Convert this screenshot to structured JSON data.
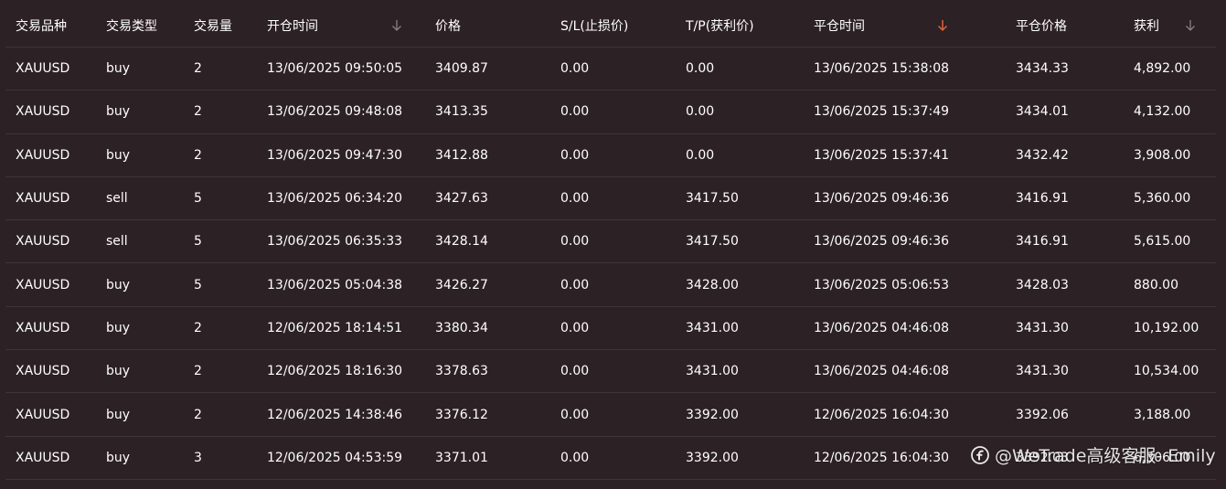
{
  "headers": [
    "交易品种",
    "交易类型",
    "交易量",
    "开仓时间",
    "价格",
    "S/L(止损价)",
    "T/P(获利价)",
    "平仓时间",
    "平仓价格",
    "获利"
  ],
  "sort_icons": {
    "open_time": {
      "icon": "arrow-down-icon",
      "color": "#8a8082"
    },
    "close_time": {
      "icon": "arrow-down-icon",
      "color": "#e0623a"
    },
    "profit": {
      "icon": "arrow-down-icon",
      "color": "#8a8082"
    }
  },
  "rows": [
    [
      "XAUUSD",
      "buy",
      "2",
      "13/06/2025 09:50:05",
      "3409.87",
      "0.00",
      "0.00",
      "13/06/2025 15:38:08",
      "3434.33",
      "4,892.00"
    ],
    [
      "XAUUSD",
      "buy",
      "2",
      "13/06/2025 09:48:08",
      "3413.35",
      "0.00",
      "0.00",
      "13/06/2025 15:37:49",
      "3434.01",
      "4,132.00"
    ],
    [
      "XAUUSD",
      "buy",
      "2",
      "13/06/2025 09:47:30",
      "3412.88",
      "0.00",
      "0.00",
      "13/06/2025 15:37:41",
      "3432.42",
      "3,908.00"
    ],
    [
      "XAUUSD",
      "sell",
      "5",
      "13/06/2025 06:34:20",
      "3427.63",
      "0.00",
      "3417.50",
      "13/06/2025 09:46:36",
      "3416.91",
      "5,360.00"
    ],
    [
      "XAUUSD",
      "sell",
      "5",
      "13/06/2025 06:35:33",
      "3428.14",
      "0.00",
      "3417.50",
      "13/06/2025 09:46:36",
      "3416.91",
      "5,615.00"
    ],
    [
      "XAUUSD",
      "buy",
      "5",
      "13/06/2025 05:04:38",
      "3426.27",
      "0.00",
      "3428.00",
      "13/06/2025 05:06:53",
      "3428.03",
      "880.00"
    ],
    [
      "XAUUSD",
      "buy",
      "2",
      "12/06/2025 18:14:51",
      "3380.34",
      "0.00",
      "3431.00",
      "13/06/2025 04:46:08",
      "3431.30",
      "10,192.00"
    ],
    [
      "XAUUSD",
      "buy",
      "2",
      "12/06/2025 18:16:30",
      "3378.63",
      "0.00",
      "3431.00",
      "13/06/2025 04:46:08",
      "3431.30",
      "10,534.00"
    ],
    [
      "XAUUSD",
      "buy",
      "2",
      "12/06/2025 14:38:46",
      "3376.12",
      "0.00",
      "3392.00",
      "12/06/2025 16:04:30",
      "3392.06",
      "3,188.00"
    ],
    [
      "XAUUSD",
      "buy",
      "3",
      "12/06/2025 04:53:59",
      "3371.01",
      "0.00",
      "3392.00",
      "12/06/2025 16:04:30",
      "3392.03",
      "6,306.00"
    ]
  ],
  "watermark": {
    "text": "@WeTrade高级客服- Emily",
    "icon": "weibo-logo-icon"
  }
}
